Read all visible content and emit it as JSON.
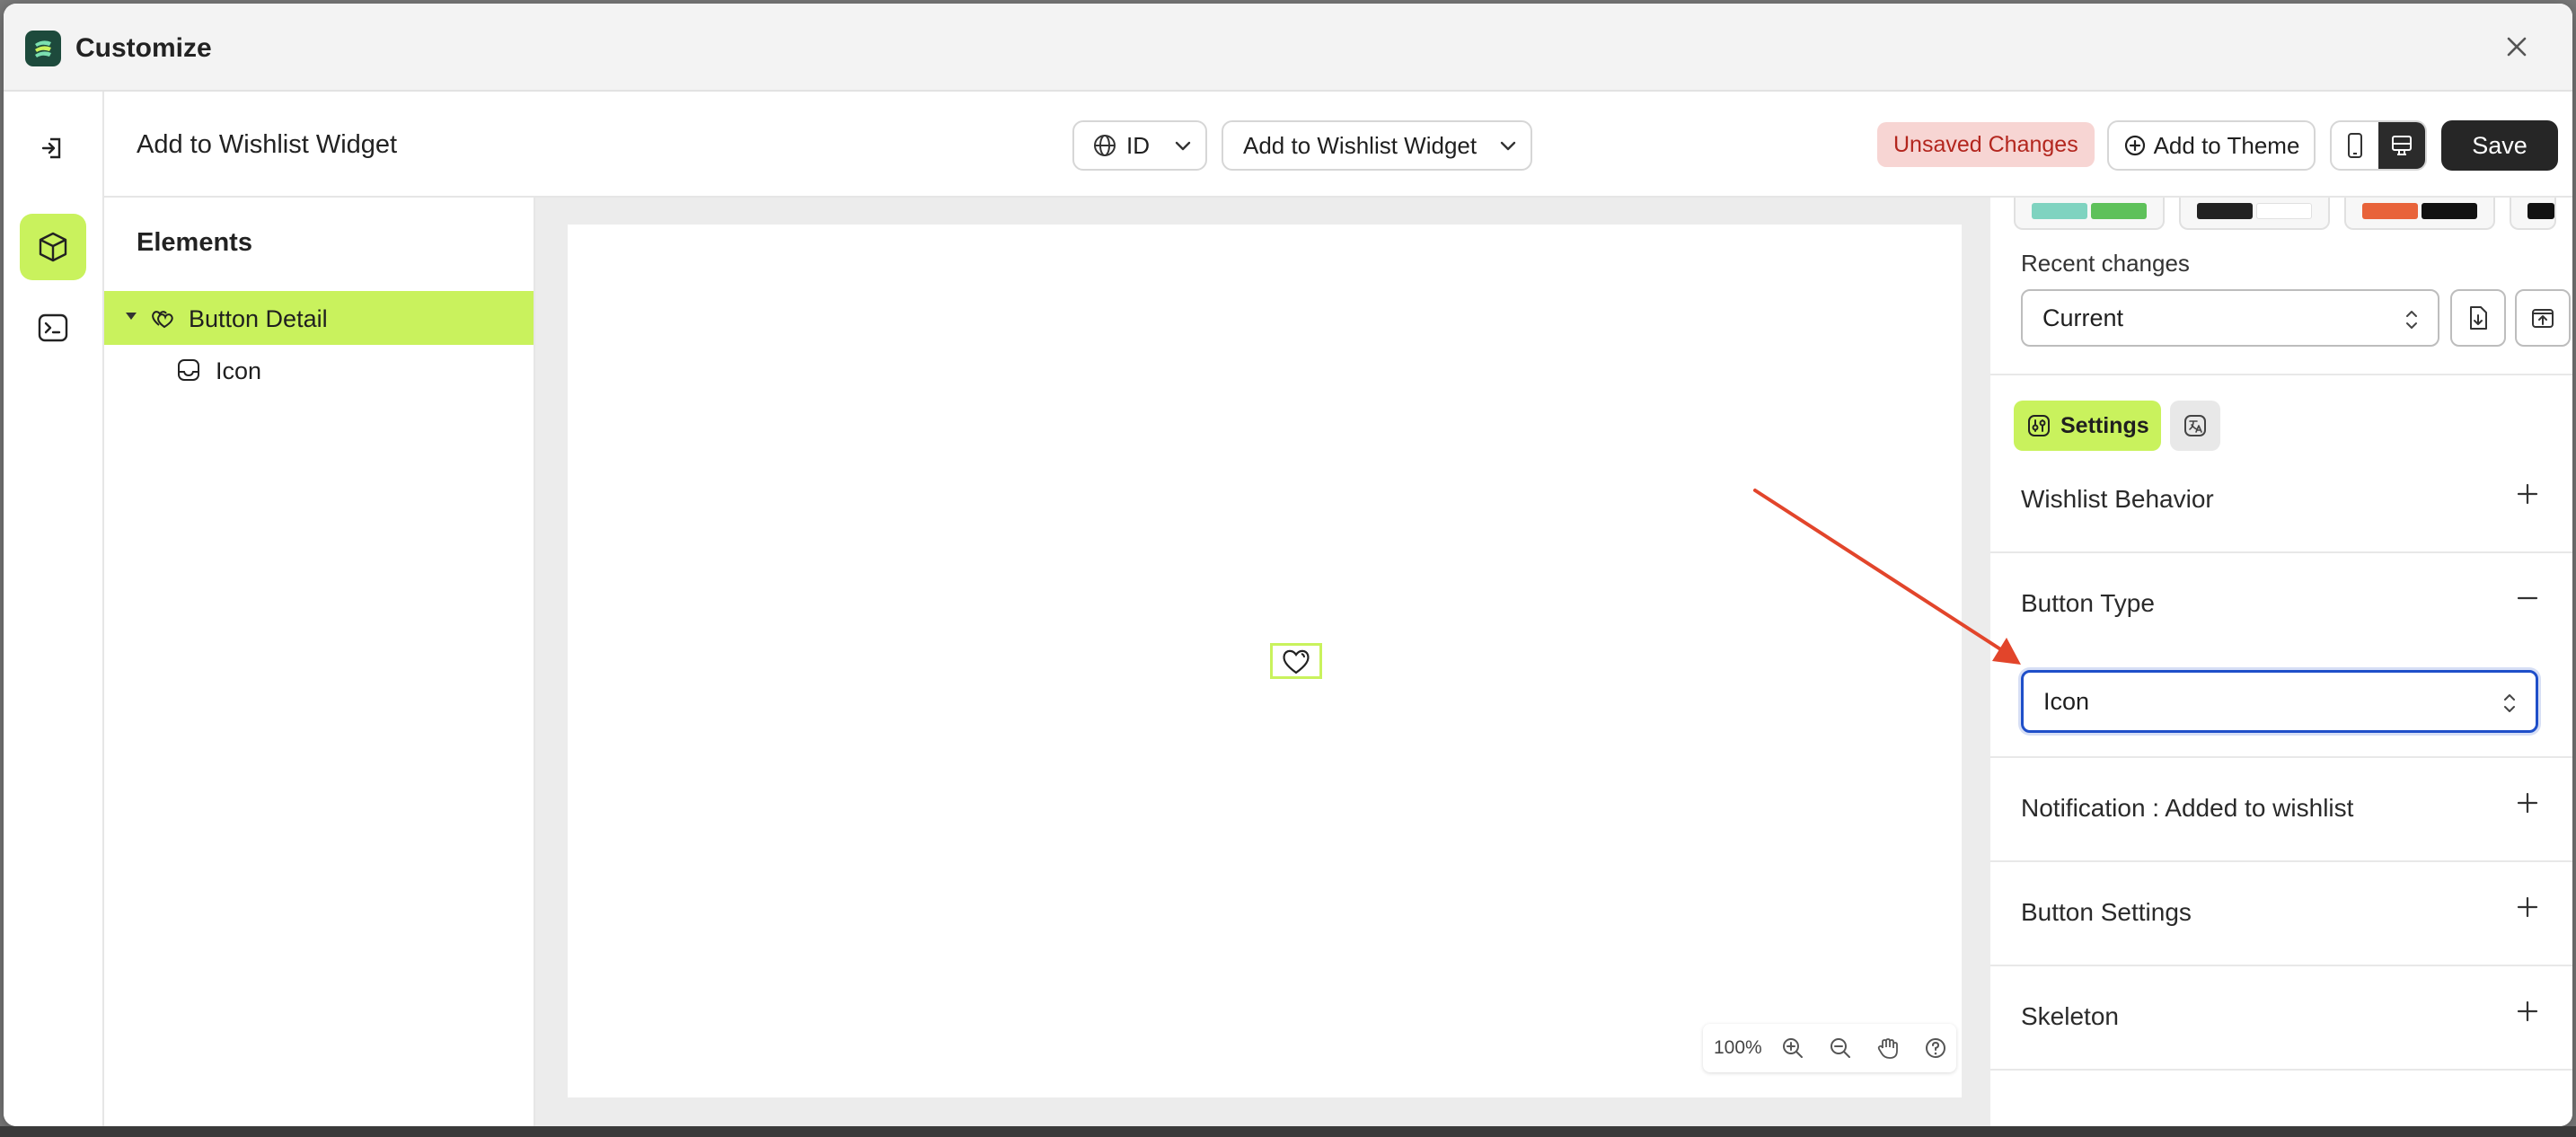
{
  "window": {
    "title": "Customize"
  },
  "toolbar": {
    "page_name": "Add to Wishlist Widget",
    "language": "ID",
    "widget_select": "Add to Wishlist Widget",
    "unsaved_badge": "Unsaved Changes",
    "add_to_theme": "Add to Theme",
    "save": "Save"
  },
  "elements": {
    "title": "Elements",
    "tree": [
      {
        "label": "Button Detail",
        "selected": true
      },
      {
        "label": "Icon",
        "selected": false
      }
    ]
  },
  "canvas": {
    "zoom": "100%"
  },
  "right_panel": {
    "theme_swatches": [
      [
        "#7fd3c0",
        "#5ec15a"
      ],
      [
        "#222222",
        "#ffffff"
      ],
      [
        "#e8633a",
        "#111111"
      ],
      [
        "#111111"
      ]
    ],
    "recent_changes_label": "Recent changes",
    "recent_changes_value": "Current",
    "settings_tab": "Settings",
    "sections": {
      "wishlist_behavior": "Wishlist Behavior",
      "button_type": "Button Type",
      "button_type_value": "Icon",
      "notification": "Notification : Added to wishlist",
      "button_settings": "Button Settings",
      "skeleton": "Skeleton"
    }
  },
  "colors": {
    "accent": "#c9f25d",
    "focus_border": "#1f4fc9",
    "badge_bg": "#f7d5d3",
    "badge_text": "#b3261e",
    "arrow": "#e2452b"
  }
}
